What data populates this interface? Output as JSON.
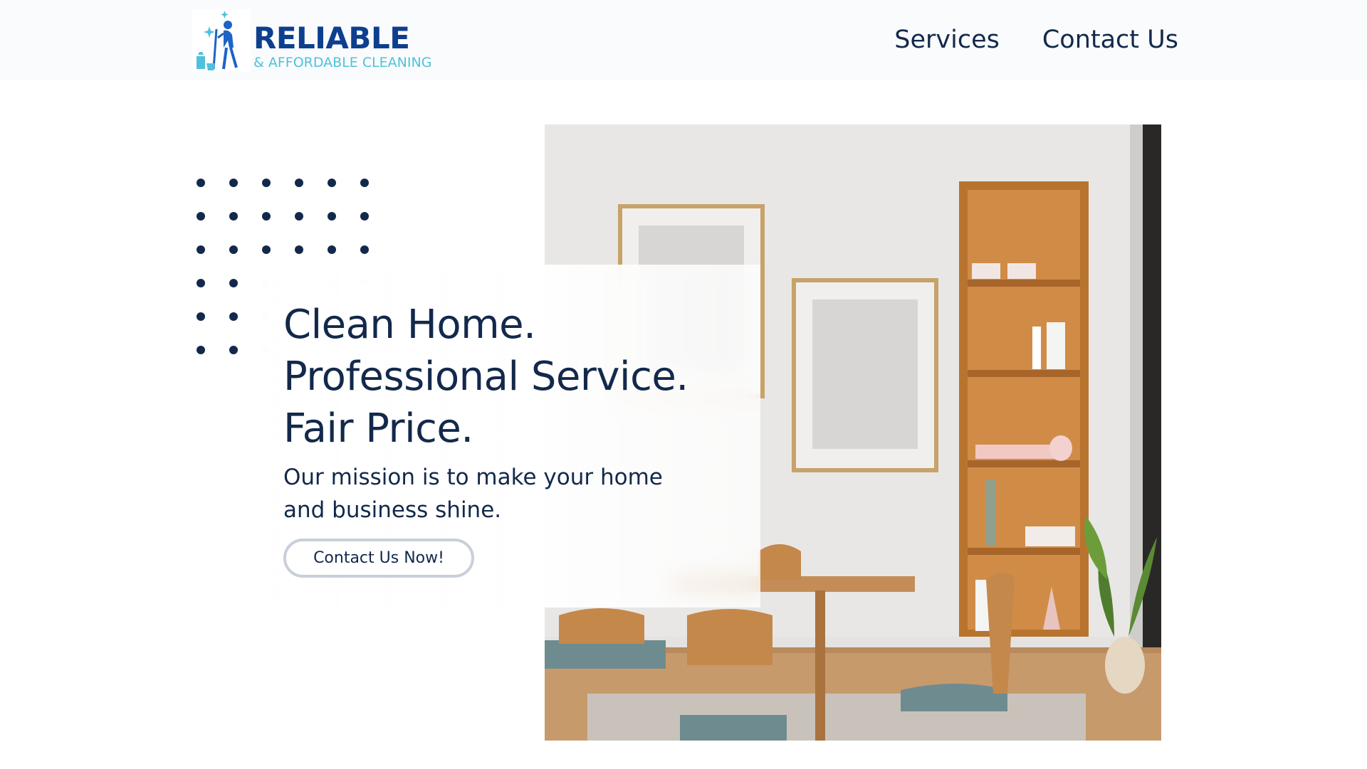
{
  "brand": {
    "title": "RELIABLE",
    "subtitle": "& AFFORDABLE CLEANING",
    "logo_icon": "cleaning-lady-icon",
    "colors": {
      "title": "#0d3f8f",
      "subtitle": "#4fc1dd",
      "icon": "#1e63c5"
    }
  },
  "nav": {
    "items": [
      {
        "label": "Services"
      },
      {
        "label": "Contact Us"
      }
    ]
  },
  "hero": {
    "headline": [
      "Clean Home.",
      "Professional Service.",
      "Fair Price."
    ],
    "mission": "Our mission is to make your home and business shine.",
    "cta_label": "Contact Us Now!",
    "image_description_icon": "interior-photo",
    "decor_icon": "dot-grid-icon"
  },
  "theme": {
    "text": "#13294b",
    "header_bg": "#fafbfc",
    "button_border": "#c9cfd9",
    "dot_color": "#13294b"
  }
}
